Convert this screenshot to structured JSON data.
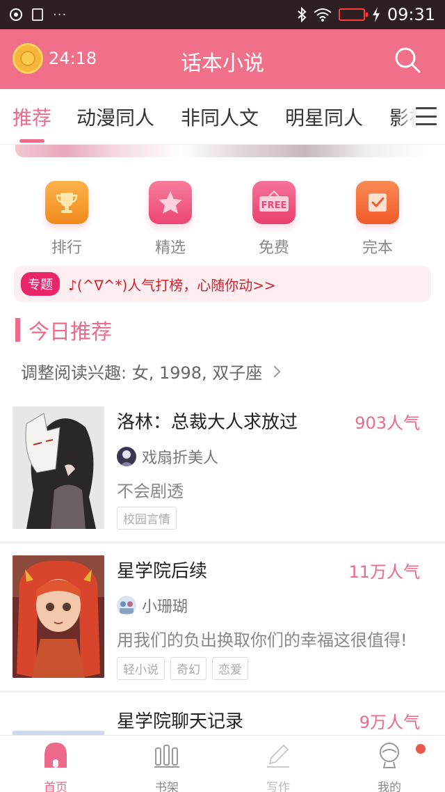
{
  "status_bar": {
    "left_dots": "···",
    "time": "09:31",
    "icons": [
      "record-icon",
      "image-icon",
      "bluetooth-icon",
      "wifi-icon",
      "battery-icon",
      "charging-icon"
    ]
  },
  "header": {
    "timer": "24:18",
    "title": "话本小说",
    "icons": [
      "alarm-coin-icon",
      "search-icon"
    ]
  },
  "tabs": [
    {
      "label": "推荐",
      "active": true
    },
    {
      "label": "动漫同人",
      "active": false
    },
    {
      "label": "非同人文",
      "active": false
    },
    {
      "label": "明星同人",
      "active": false
    },
    {
      "label": "影视",
      "active": false
    }
  ],
  "quick_entries": [
    {
      "label": "排行",
      "icon": "trophy-icon",
      "color": "#f59a2a"
    },
    {
      "label": "精选",
      "icon": "star-icon",
      "color": "#f0577f"
    },
    {
      "label": "免费",
      "icon": "free-tag-icon",
      "color": "#ef4f78"
    },
    {
      "label": "完本",
      "icon": "check-note-icon",
      "color": "#f36a3a"
    }
  ],
  "notice": {
    "badge": "专题",
    "text": "♪(^∇^*)人气打榜，心随你动>>"
  },
  "section": {
    "title": "今日推荐",
    "interest": "调整阅读兴趣: 女, 1998, 双子座"
  },
  "books": [
    {
      "title": "洛林：总裁大人求放过",
      "popularity": "903人气",
      "author": "戏扇折美人",
      "desc": "不会剧透",
      "tags": [
        "校园言情"
      ]
    },
    {
      "title": "星学院后续",
      "popularity": "11万人气",
      "author": "小珊瑚",
      "desc": "用我们的负出换取你们的幸福这很值得!",
      "tags": [
        "轻小说",
        "奇幻",
        "恋爱"
      ]
    },
    {
      "title": "星学院聊天记录",
      "popularity": "9万人气",
      "author": "",
      "desc": "",
      "tags": []
    }
  ],
  "bottom_nav": [
    {
      "label": "首页",
      "icon": "home-icon",
      "active": true
    },
    {
      "label": "书架",
      "icon": "bookshelf-icon",
      "active": false
    },
    {
      "label": "写作",
      "icon": "pen-icon",
      "active": false
    },
    {
      "label": "我的",
      "icon": "profile-icon",
      "active": false
    }
  ],
  "colors": {
    "accent": "#ee6a8a",
    "header_bg": "#f0708a",
    "status_bg": "#2e1f22",
    "notice_text": "#d4212a"
  }
}
